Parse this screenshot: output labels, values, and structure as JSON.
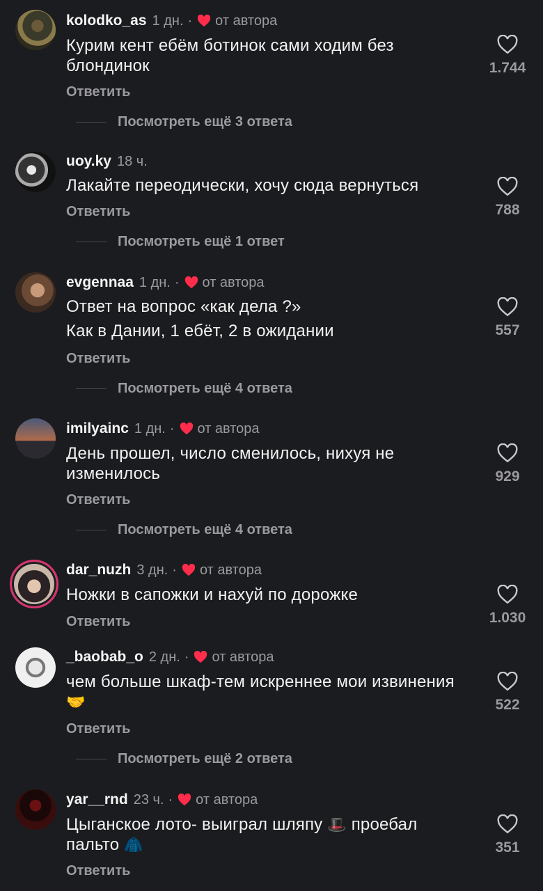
{
  "reply_label": "Ответить",
  "author_badge": "от автора",
  "accent_heart": "#ff2d4b",
  "icons": {
    "like": "heart-outline-icon",
    "author_like": "heart-filled-icon"
  },
  "comments": [
    {
      "username": "kolodko_as",
      "time": "1 дн.",
      "author_liked": true,
      "text": "Курим кент ебём ботинок сами ходим без блондинок",
      "likes": "1.744",
      "more_replies": "Посмотреть ещё 3 ответа"
    },
    {
      "username": "uoy.ky",
      "time": "18 ч.",
      "author_liked": false,
      "text": "Лакайте переодически, хочу сюда вернуться",
      "likes": "788",
      "more_replies": "Посмотреть ещё 1 ответ"
    },
    {
      "username": "evgennaa",
      "time": "1 дн.",
      "author_liked": true,
      "text": "Ответ на вопрос «как дела ?»",
      "text_line2": "Как в Дании, 1 ебёт, 2 в ожидании",
      "likes": "557",
      "more_replies": "Посмотреть ещё 4 ответа"
    },
    {
      "username": "imilyainc",
      "time": "1 дн.",
      "author_liked": true,
      "text": "День прошел, число сменилось, нихуя не изменилось",
      "likes": "929",
      "more_replies": "Посмотреть ещё 4 ответа"
    },
    {
      "username": "dar_nuzh",
      "time": "3 дн.",
      "author_liked": true,
      "text": "Ножки в сапожки и нахуй по дорожке",
      "likes": "1.030",
      "more_replies": ""
    },
    {
      "username": "_baobab_o",
      "time": "2 дн.",
      "author_liked": true,
      "text": "чем больше шкаф-тем искреннее мои извинения",
      "emoji": "🤝",
      "likes": "522",
      "more_replies": "Посмотреть ещё 2 ответа"
    },
    {
      "username": "yar__rnd",
      "time": "23 ч.",
      "author_liked": true,
      "text_a": "Цыганское лото- выиграл шляпу",
      "emoji_a": "🎩",
      "text_b": "проебал пальто",
      "emoji_b": "🧥",
      "likes": "351",
      "more_replies": ""
    }
  ]
}
